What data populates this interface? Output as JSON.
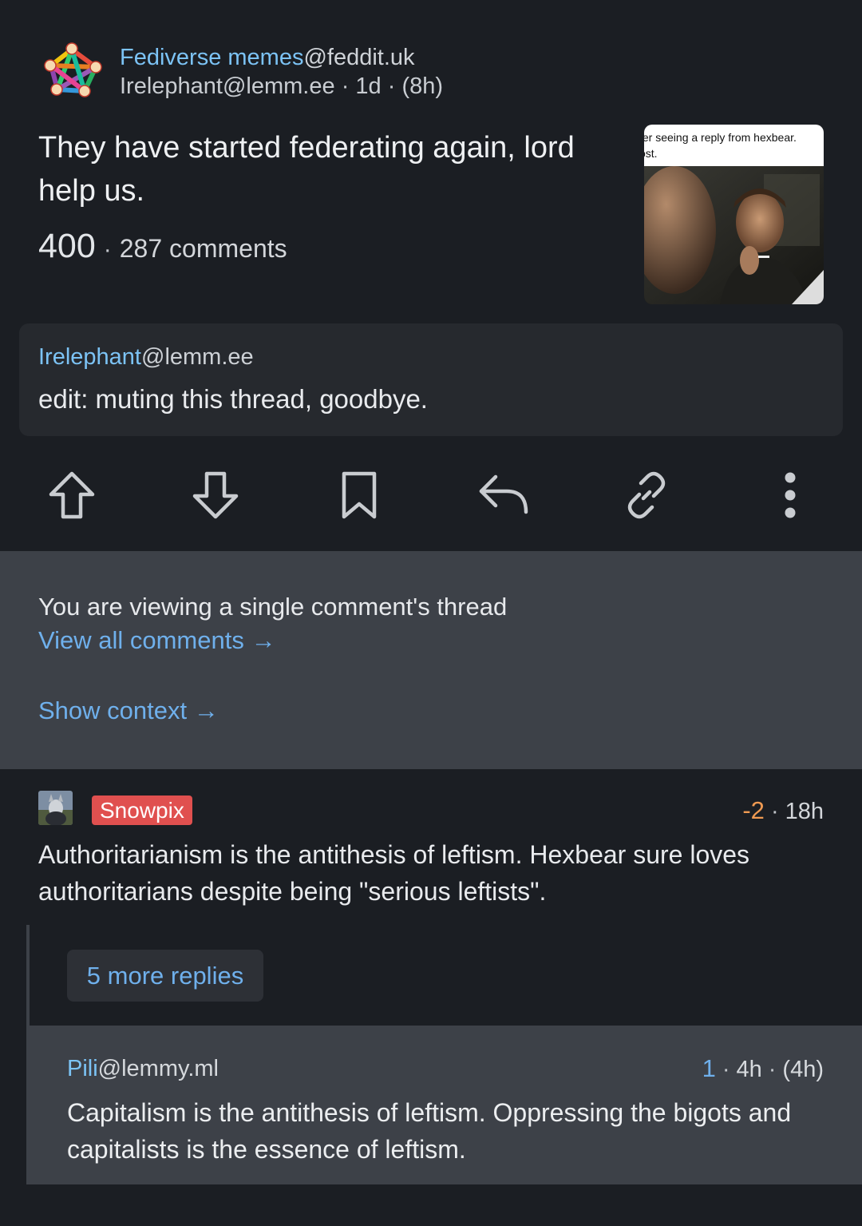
{
  "post": {
    "community_name": "Fediverse memes",
    "community_instance": "@feddit.uk",
    "author": "Irelephant@lemm.ee",
    "sep1": "·",
    "age": "1d",
    "sep2": "·",
    "edited": "(8h)",
    "title": "They have started federating again, lord help us.",
    "score": "400",
    "dot": "·",
    "comments": "287 comments",
    "thumbnail_caption_line1": "ter seeing a reply from hexbear.",
    "thumbnail_caption_line2": "ost."
  },
  "body": {
    "author_user": "Irelephant",
    "author_instance": "@lemm.ee",
    "text": "edit: muting this thread, goodbye."
  },
  "actions": {
    "icons": [
      "upvote-icon",
      "downvote-icon",
      "bookmark-icon",
      "reply-icon",
      "link-icon",
      "more-vertical-icon"
    ]
  },
  "thread": {
    "note": "You are viewing a single comment's thread",
    "view_all": "View all comments →",
    "show_context": "Show context →"
  },
  "comment1": {
    "author": "Snowpix",
    "score": "-2",
    "sep": "·",
    "age": "18h",
    "text": "Authoritarianism is the antithesis of leftism. Hexbear sure loves authoritarians despite being \"serious leftists\"."
  },
  "more_replies": "5 more replies",
  "comment2": {
    "author_user": "Pili",
    "author_instance": "@lemmy.ml",
    "score": "1",
    "sep1": "·",
    "age": "4h",
    "sep2": "·",
    "edited": "(4h)",
    "text": "Capitalism is the antithesis of leftism. Oppressing the bigots and capitalists is the essence of leftism."
  },
  "colors": {
    "background": "#1b1e23",
    "link": "#7cc3f5",
    "accent_blue": "#6fb0ec",
    "op_badge": "#e0504f",
    "negative_score": "#ef9a52",
    "panel": "#3d4148"
  }
}
